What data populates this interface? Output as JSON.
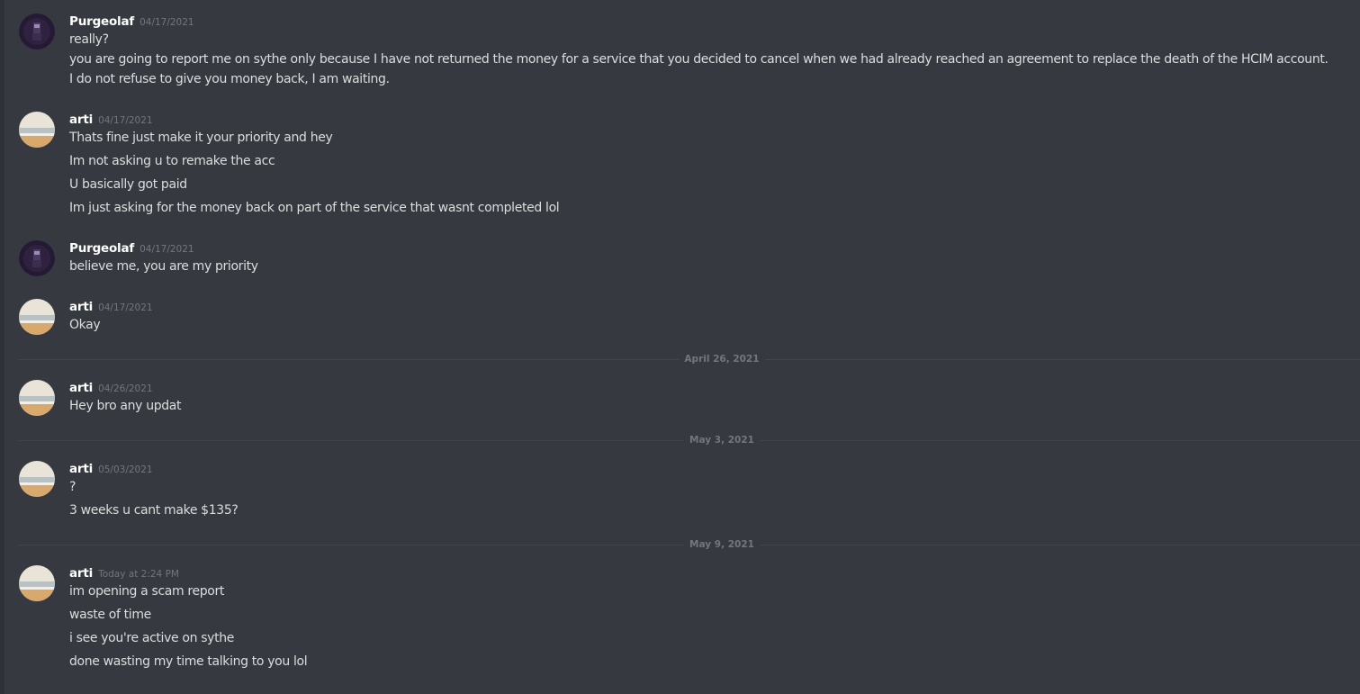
{
  "users": {
    "purgeolaf": {
      "name": "Purgeolaf",
      "avatar_icon": "dark-purple-character-avatar-icon",
      "color": "#ffffff"
    },
    "arti": {
      "name": "arti",
      "avatar_icon": "beach-sunset-avatar-icon",
      "color": "#ffffff"
    }
  },
  "colors": {
    "background": "#36393f",
    "text": "#dcddde",
    "timestamp": "#72767d",
    "divider": "#42454a"
  },
  "messages": [
    {
      "author": "Purgeolaf",
      "timestamp": "04/17/2021",
      "lines": [
        "really?",
        "you are going to report me on sythe only because I have not returned the money for a service that you decided to cancel when we had already reached an agreement to replace the death of the HCIM account.",
        "I do not refuse to give you money back, I am waiting."
      ]
    },
    {
      "author": "arti",
      "timestamp": "04/17/2021",
      "lines": [
        "Thats fine just make it your priority and hey",
        "Im not asking u to remake the acc",
        "U basically got paid",
        "Im just asking for the money back on part of the service that wasnt completed lol"
      ]
    },
    {
      "author": "Purgeolaf",
      "timestamp": "04/17/2021",
      "lines": [
        "believe me, you are my priority"
      ]
    },
    {
      "author": "arti",
      "timestamp": "04/17/2021",
      "lines": [
        "Okay"
      ]
    },
    {
      "author": "arti",
      "timestamp": "04/26/2021",
      "lines": [
        "Hey bro any updat"
      ]
    },
    {
      "author": "arti",
      "timestamp": "05/03/2021",
      "lines": [
        "?",
        "3 weeks u cant make $135?"
      ]
    },
    {
      "author": "arti",
      "timestamp": "Today at 2:24 PM",
      "lines": [
        "im opening a scam report",
        "waste of time",
        "i see you're active on sythe",
        "done wasting my time talking to you lol"
      ]
    }
  ],
  "date_dividers": [
    "April 26, 2021",
    "May 3, 2021",
    "May 9, 2021"
  ]
}
